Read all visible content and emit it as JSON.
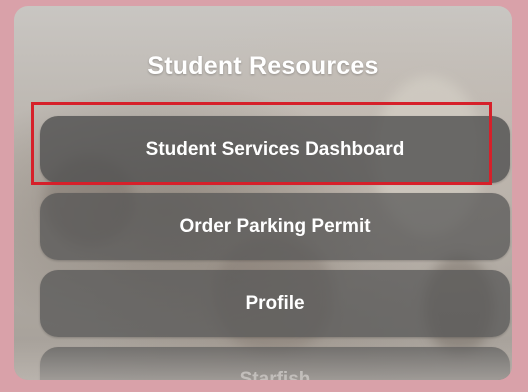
{
  "panel": {
    "title": "Student Resources"
  },
  "buttons": [
    {
      "label": "Student Services Dashboard"
    },
    {
      "label": "Order Parking Permit"
    },
    {
      "label": "Profile"
    },
    {
      "label": "Starfish"
    }
  ],
  "colors": {
    "highlight": "#d6202a",
    "button_bg": "#555555",
    "frame": "#d9a1a9"
  }
}
